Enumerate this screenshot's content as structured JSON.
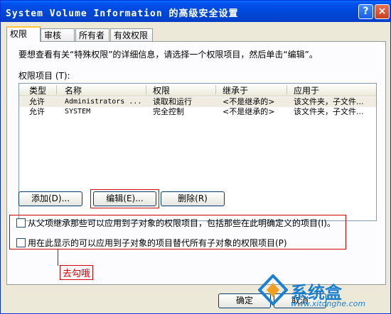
{
  "window": {
    "title": "System Volume Information 的高级安全设置",
    "help_label": "?",
    "close_label": "×"
  },
  "tabs": [
    {
      "label": "权限"
    },
    {
      "label": "审核"
    },
    {
      "label": "所有者"
    },
    {
      "label": "有效权限"
    }
  ],
  "description": "要想查看有关“特殊权限”的详细信息，请选择一个权限项目，然后单击“编辑”。",
  "permission_list": {
    "label": "权限项目 (T):",
    "columns": [
      "类型",
      "名称",
      "权限",
      "继承于",
      "应用于"
    ],
    "rows": [
      [
        "允许",
        "Administrators ...",
        "读取和运行",
        "<不是继承的>",
        "该文件夹，子文件..."
      ],
      [
        "允许",
        "SYSTEM",
        "完全控制",
        "<不是继承的>",
        "该文件夹，子文件..."
      ]
    ]
  },
  "buttons": {
    "add": "添加(D)...",
    "edit": "编辑(E)...",
    "remove": "删除(R)",
    "ok": "确定",
    "cancel": "取消"
  },
  "checkboxes": [
    {
      "label": "从父项继承那些可以应用到子对象的权限项目，包括那些在此明确定义的项目(I)。",
      "checked": false
    },
    {
      "label": "用在此显示的可以应用到子对象的项目替代所有子对象的权限项目(P)",
      "checked": false
    }
  ],
  "annotation": "去勾哦",
  "watermark": {
    "brand": "系统盒",
    "url": "www.xitonghe.com"
  },
  "colors": {
    "annotation_red": "#d00000",
    "titlebar_blue": "#0050ee",
    "watermark_blue": "#1b7fd2"
  }
}
